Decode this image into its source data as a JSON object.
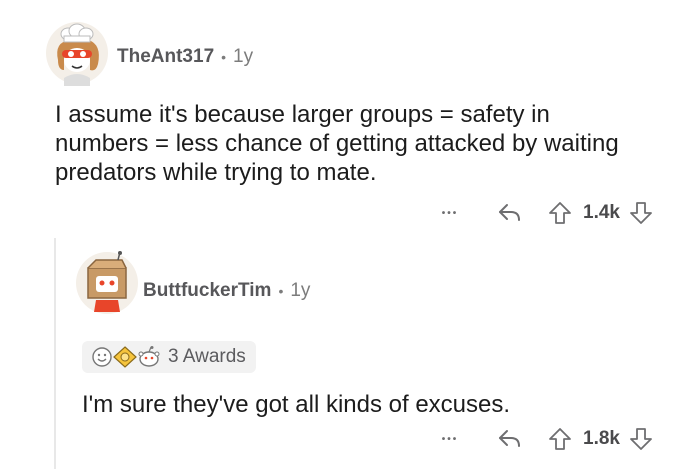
{
  "comments": [
    {
      "author": "TheAnt317",
      "separator": "•",
      "age": "1y",
      "text_lines": [
        "I assume it's because larger groups = safety in",
        "numbers = less chance of getting attacked by waiting",
        "predators while trying to mate."
      ],
      "more_label": "•••",
      "score": "1.4k",
      "avatar": "chef-avatar-icon"
    },
    {
      "author": "ButtfuckerTim",
      "separator": "•",
      "age": "1y",
      "awards_label": "3 Awards",
      "text": "I'm sure they've got all kinds of excuses.",
      "more_label": "•••",
      "score": "1.8k",
      "avatar": "box-robot-avatar-icon"
    }
  ],
  "colors": {
    "upvote": "#6e6e70",
    "text": "#1c1c1c",
    "meta": "#7c7c7c",
    "award_bg": "#f2f2f2"
  }
}
